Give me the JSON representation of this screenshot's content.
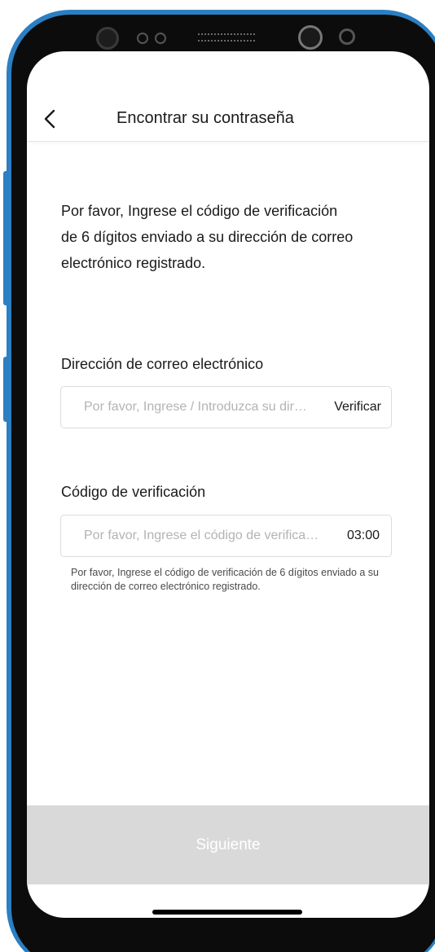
{
  "header": {
    "title": "Encontrar su contraseña",
    "back_icon": "chevron-left-icon"
  },
  "intro": {
    "text": "Por favor, Ingrese el código de verificación de 6 dígitos enviado a su dirección de correo electrónico registrado."
  },
  "email_field": {
    "label": "Dirección de correo electrónico",
    "placeholder": "Por favor, Ingrese / Introduzca su dirección de correo electrónico",
    "action_label": "Verificar"
  },
  "code_field": {
    "label": "Código de verificación",
    "placeholder": "Por favor, Ingrese el código de verificación",
    "timer": "03:00",
    "hint": "Por favor, Ingrese el código de verificación de 6 dígitos enviado a su dirección de correo electrónico registrado."
  },
  "footer": {
    "next_label": "Siguiente"
  },
  "colors": {
    "phone_frame": "#2b7fc2",
    "disabled_button": "#d9d9d9",
    "text": "#1a1a1a",
    "placeholder": "#b3b3b3"
  }
}
